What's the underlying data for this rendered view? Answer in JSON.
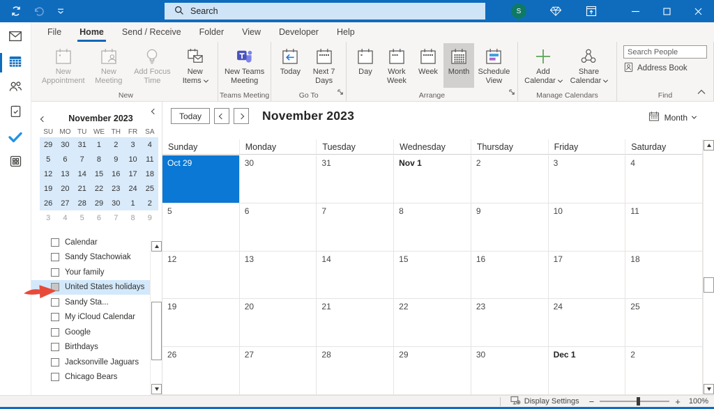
{
  "titlebar": {
    "search_placeholder": "Search",
    "avatar_initial": "S",
    "accent_color": "#0f6cbd"
  },
  "tabs": {
    "items": [
      "File",
      "Home",
      "Send / Receive",
      "Folder",
      "View",
      "Developer",
      "Help"
    ],
    "active": "Home"
  },
  "ribbon": {
    "groups": [
      {
        "label": "New",
        "buttons": [
          {
            "name": "new-appointment",
            "label": "New Appointment",
            "icon": "cal-plain",
            "disabled": true
          },
          {
            "name": "new-meeting",
            "label": "New Meeting",
            "icon": "cal-person",
            "disabled": true
          },
          {
            "name": "add-focus-time",
            "label": "Add Focus Time",
            "icon": "bulb",
            "disabled": true
          },
          {
            "name": "new-items",
            "label": "New Items",
            "icon": "new-items",
            "dropdown": true
          }
        ]
      },
      {
        "label": "Teams Meeting",
        "buttons": [
          {
            "name": "new-teams-meeting",
            "label": "New Teams Meeting",
            "icon": "teams"
          }
        ]
      },
      {
        "label": "Go To",
        "launcher": true,
        "buttons": [
          {
            "name": "today",
            "label": "Today",
            "icon": "cal-today"
          },
          {
            "name": "next-7-days",
            "label": "Next 7 Days",
            "icon": "cal-7"
          }
        ]
      },
      {
        "label": "Arrange",
        "launcher": true,
        "buttons": [
          {
            "name": "day",
            "label": "Day",
            "icon": "cal-day"
          },
          {
            "name": "work-week",
            "label": "Work Week",
            "icon": "cal-workweek"
          },
          {
            "name": "week",
            "label": "Week",
            "icon": "cal-week"
          },
          {
            "name": "month",
            "label": "Month",
            "icon": "cal-month",
            "selected": true
          },
          {
            "name": "schedule-view",
            "label": "Schedule View",
            "icon": "cal-schedule"
          }
        ]
      },
      {
        "label": "Manage Calendars",
        "buttons": [
          {
            "name": "add-calendar",
            "label": "Add Calendar",
            "icon": "plus",
            "dropdown": true
          },
          {
            "name": "share-calendar",
            "label": "Share Calendar",
            "icon": "share",
            "dropdown": true
          }
        ]
      },
      {
        "label": "Find",
        "type": "find",
        "search_placeholder": "Search People",
        "address_book_label": "Address Book"
      }
    ]
  },
  "nav_rail": {
    "items": [
      {
        "name": "mail",
        "icon": "rail-mail",
        "active": false
      },
      {
        "name": "calendar",
        "icon": "rail-cal",
        "active": true
      },
      {
        "name": "people",
        "icon": "rail-people",
        "active": false
      },
      {
        "name": "tasks",
        "icon": "rail-tasks",
        "active": false
      },
      {
        "name": "todo",
        "icon": "rail-todo",
        "active": false
      },
      {
        "name": "more-apps",
        "icon": "rail-apps",
        "active": false
      }
    ]
  },
  "folder_pane": {
    "mini_calendar": {
      "title": "November 2023",
      "day_headers": [
        "SU",
        "MO",
        "TU",
        "WE",
        "TH",
        "FR",
        "SA"
      ],
      "weeks": [
        [
          "29",
          "30",
          "31",
          "1",
          "2",
          "3",
          "4"
        ],
        [
          "5",
          "6",
          "7",
          "8",
          "9",
          "10",
          "11"
        ],
        [
          "12",
          "13",
          "14",
          "15",
          "16",
          "17",
          "18"
        ],
        [
          "19",
          "20",
          "21",
          "22",
          "23",
          "24",
          "25"
        ],
        [
          "26",
          "27",
          "28",
          "29",
          "30",
          "1",
          "2"
        ]
      ],
      "trailing_week": [
        "3",
        "4",
        "5",
        "6",
        "7",
        "8",
        "9"
      ],
      "highlight_color": "#d9eafa"
    },
    "calendar_list": {
      "items": [
        "Calendar",
        "Sandy Stachowiak",
        "Your family",
        "United States holidays",
        "Sandy Sta...",
        "My iCloud Calendar",
        "Google",
        "Birthdays",
        "Jacksonville Jaguars",
        "Chicago Bears"
      ],
      "highlighted_item": "United States holidays",
      "highlight_color": "#d3e9fb"
    }
  },
  "main": {
    "today_label": "Today",
    "title": "November 2023",
    "view_label": "Month",
    "weekdays": [
      "Sunday",
      "Monday",
      "Tuesday",
      "Wednesday",
      "Thursday",
      "Friday",
      "Saturday"
    ],
    "selected_color": "#0a78d4",
    "weeks": [
      [
        {
          "label": "Oct 29",
          "selected": true
        },
        {
          "label": "30"
        },
        {
          "label": "31"
        },
        {
          "label": "Nov 1",
          "bold": true
        },
        {
          "label": "2"
        },
        {
          "label": "3"
        },
        {
          "label": "4"
        }
      ],
      [
        {
          "label": "5"
        },
        {
          "label": "6"
        },
        {
          "label": "7"
        },
        {
          "label": "8"
        },
        {
          "label": "9"
        },
        {
          "label": "10"
        },
        {
          "label": "11"
        }
      ],
      [
        {
          "label": "12"
        },
        {
          "label": "13"
        },
        {
          "label": "14"
        },
        {
          "label": "15"
        },
        {
          "label": "16"
        },
        {
          "label": "17"
        },
        {
          "label": "18"
        }
      ],
      [
        {
          "label": "19"
        },
        {
          "label": "20"
        },
        {
          "label": "21"
        },
        {
          "label": "22"
        },
        {
          "label": "23"
        },
        {
          "label": "24"
        },
        {
          "label": "25"
        }
      ],
      [
        {
          "label": "26"
        },
        {
          "label": "27"
        },
        {
          "label": "28"
        },
        {
          "label": "29"
        },
        {
          "label": "30"
        },
        {
          "label": "Dec 1",
          "bold": true
        },
        {
          "label": "2"
        }
      ]
    ]
  },
  "statusbar": {
    "display_settings_label": "Display Settings",
    "zoom_level": "100%"
  }
}
